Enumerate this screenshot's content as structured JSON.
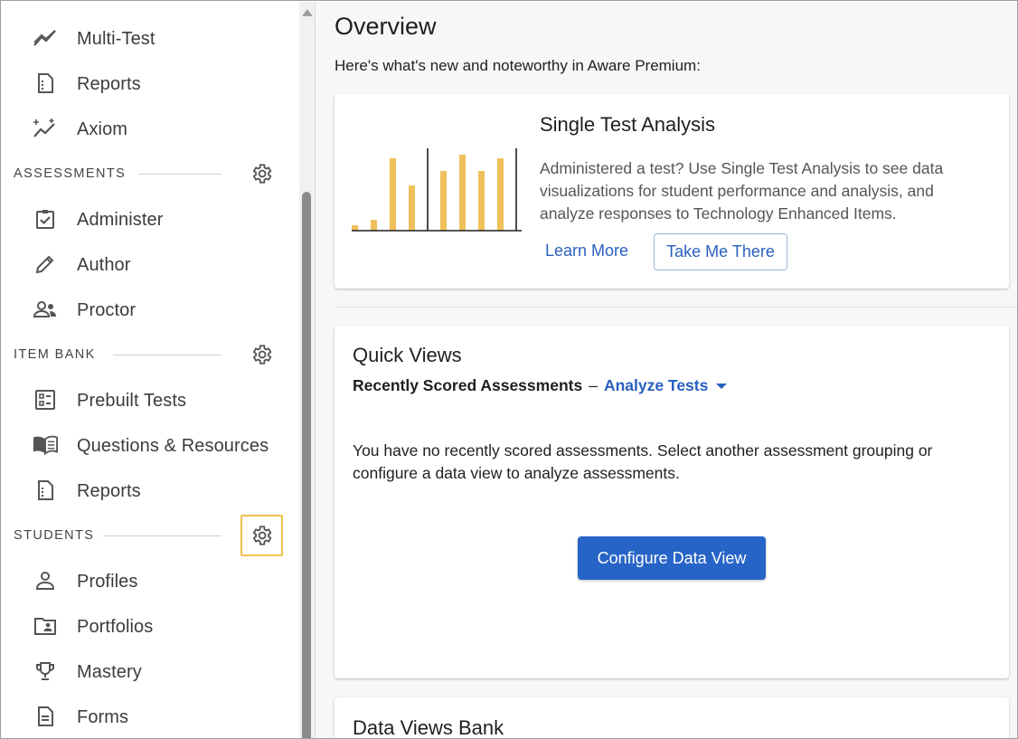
{
  "sidebar": {
    "items_top": [
      {
        "label": "Multi-Test",
        "icon": "multi-test-icon"
      },
      {
        "label": "Reports",
        "icon": "report-icon"
      },
      {
        "label": "Axiom",
        "icon": "axiom-icon"
      }
    ],
    "assessments": {
      "title": "ASSESSMENTS",
      "items": [
        {
          "label": "Administer",
          "icon": "checkbox-icon"
        },
        {
          "label": "Author",
          "icon": "pencil-icon"
        },
        {
          "label": "Proctor",
          "icon": "people-icon"
        }
      ]
    },
    "item_bank": {
      "title": "ITEM BANK",
      "items": [
        {
          "label": "Prebuilt Tests",
          "icon": "list-box-icon"
        },
        {
          "label": "Questions & Resources",
          "icon": "book-icon"
        },
        {
          "label": "Reports",
          "icon": "report-icon"
        }
      ]
    },
    "students": {
      "title": "STUDENTS",
      "items": [
        {
          "label": "Profiles",
          "icon": "person-icon"
        },
        {
          "label": "Portfolios",
          "icon": "folder-person-icon"
        },
        {
          "label": "Mastery",
          "icon": "trophy-icon"
        },
        {
          "label": "Forms",
          "icon": "document-icon"
        }
      ]
    }
  },
  "main": {
    "title": "Overview",
    "subtitle": "Here's what's new and noteworthy in Aware Premium:",
    "feature_card": {
      "title": "Single Test Analysis",
      "description": "Administered a test? Use Single Test Analysis to see data visualizations for student performance and analysis, and analyze responses to Technology Enhanced Items.",
      "learn_more": "Learn More",
      "take_me_there": "Take Me There",
      "accent_color": "#f0c15a"
    },
    "quick_views": {
      "title": "Quick Views",
      "grouping_label": "Recently Scored Assessments",
      "separator": "–",
      "dropdown_value": "Analyze Tests",
      "message": "You have no recently scored assessments. Select another assessment grouping or configure a data view to analyze assessments.",
      "button": "Configure Data View"
    },
    "data_views_bank": {
      "title": "Data Views Bank"
    }
  },
  "colors": {
    "link_blue": "#2a5fbf",
    "primary_button": "#2764c7",
    "highlight": "#f0c24b"
  }
}
